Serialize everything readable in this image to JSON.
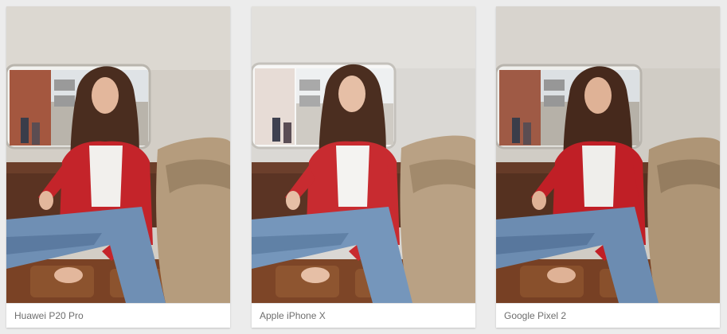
{
  "gallery": {
    "items": [
      {
        "caption": "Huawei P20 Pro"
      },
      {
        "caption": "Apple iPhone X"
      },
      {
        "caption": "Google Pixel 2"
      }
    ]
  },
  "colors": {
    "page_background": "#ececec",
    "card_background": "#ffffff",
    "caption_text": "#6e6e6e"
  }
}
